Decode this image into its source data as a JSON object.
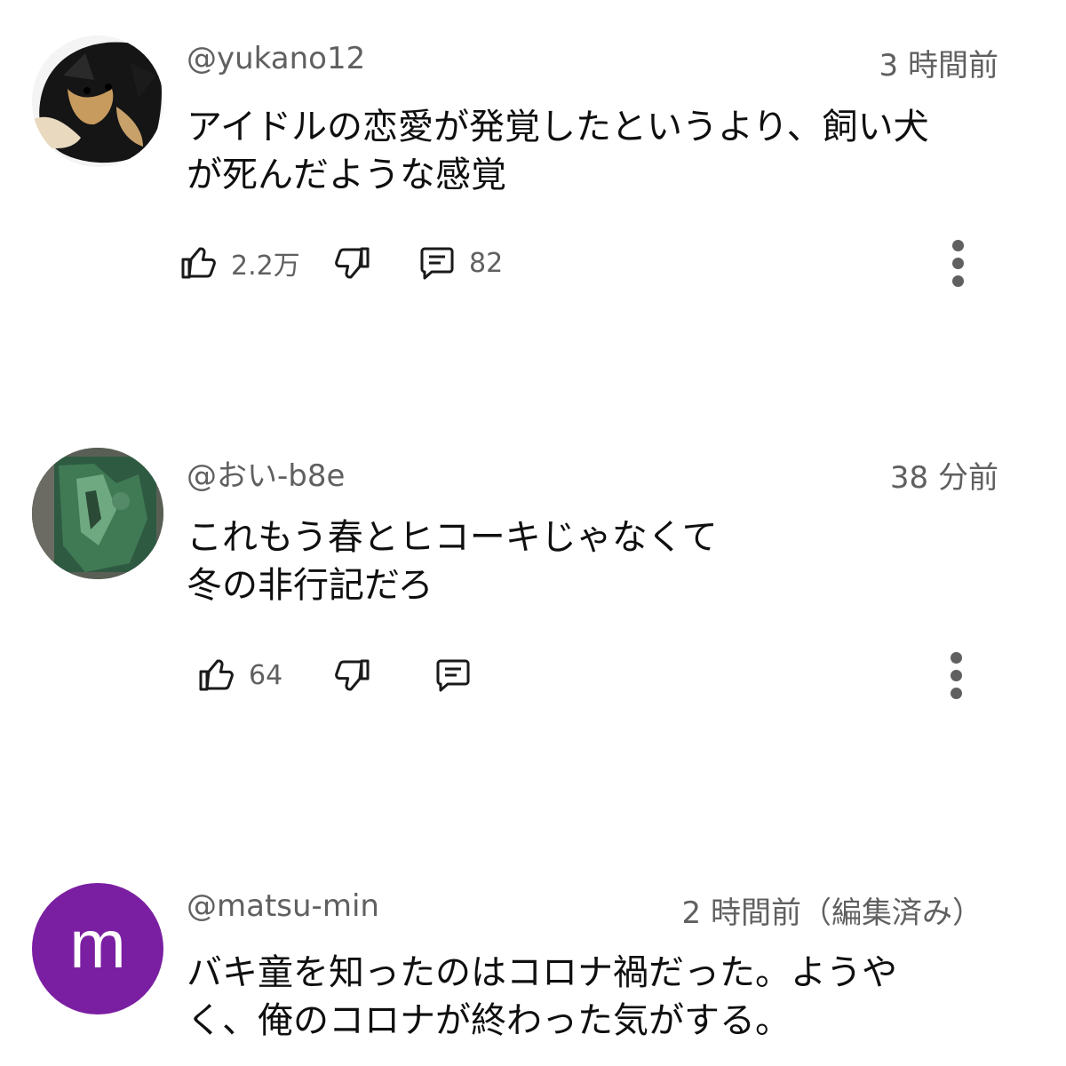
{
  "comments": [
    {
      "username": "@yukano12",
      "time": "3 時間前",
      "text": "アイドルの恋愛が発覚したというより、飼い犬\nが死んだような感覚",
      "likes": "2.2万",
      "replies": "82",
      "avatar_icon": "dog-photo-avatar"
    },
    {
      "username": "@おい-b8e",
      "time": "38 分前",
      "text": "これもう春とヒコーキじゃなくて\n冬の非行記だろ",
      "likes": "64",
      "replies": "",
      "avatar_icon": "green-textured-photo-avatar"
    },
    {
      "username": "@matsu-min",
      "time": "2 時間前（編集済み）",
      "text": "バキ童を知ったのはコロナ禍だった。ようや\nく、俺のコロナが終わった気がする。",
      "avatar_letter": "m",
      "avatar_color": "#7b1fa2"
    }
  ],
  "icons": {
    "like": "thumbs-up-icon",
    "dislike": "thumbs-down-icon",
    "reply": "comment-icon",
    "more": "more-vert-icon"
  },
  "colors": {
    "secondary_text": "#606060",
    "primary_text": "#0f0f0f",
    "background": "#ffffff"
  }
}
